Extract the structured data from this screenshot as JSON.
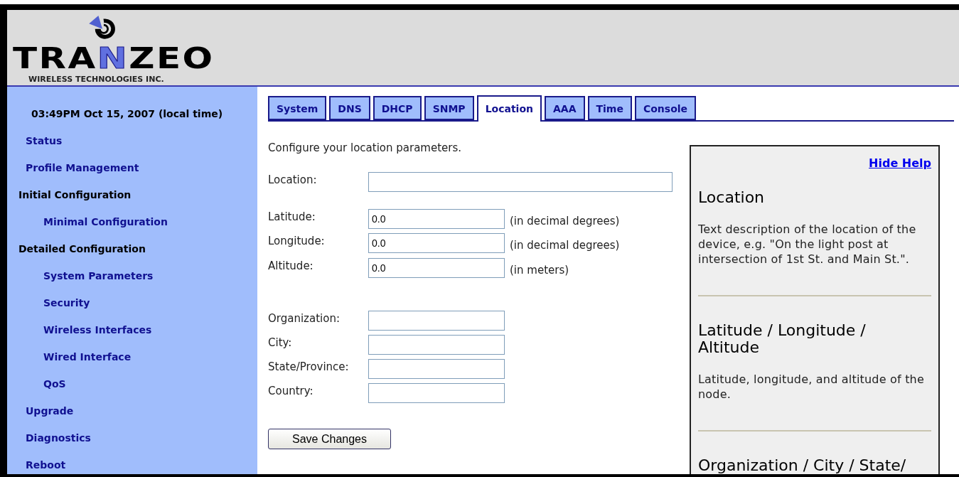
{
  "logo": {
    "wordmark": [
      {
        "text": "TRA",
        "highlighted": false
      },
      {
        "text": "N",
        "highlighted": true
      },
      {
        "text": "ZEO",
        "highlighted": false
      }
    ],
    "tagline": "WIRELESS TECHNOLOGIES INC."
  },
  "sidebar": {
    "datetime": "03:49PM Oct 15, 2007 (local time)",
    "items": [
      {
        "kind": "link",
        "label": "Status"
      },
      {
        "kind": "link",
        "label": "Profile Management"
      },
      {
        "kind": "heading",
        "label": "Initial Configuration",
        "children": [
          {
            "kind": "link",
            "label": "Minimal Configuration"
          }
        ]
      },
      {
        "kind": "heading",
        "label": "Detailed Configuration",
        "children": [
          {
            "kind": "link",
            "label": "System Parameters"
          },
          {
            "kind": "link",
            "label": "Security"
          },
          {
            "kind": "link",
            "label": "Wireless Interfaces"
          },
          {
            "kind": "link",
            "label": "Wired Interface"
          },
          {
            "kind": "link",
            "label": "QoS"
          }
        ]
      },
      {
        "kind": "link",
        "label": "Upgrade"
      },
      {
        "kind": "link",
        "label": "Diagnostics"
      },
      {
        "kind": "link",
        "label": "Reboot"
      }
    ]
  },
  "tabs": [
    {
      "label": "System",
      "selected": false
    },
    {
      "label": "DNS",
      "selected": false
    },
    {
      "label": "DHCP",
      "selected": false
    },
    {
      "label": "SNMP",
      "selected": false
    },
    {
      "label": "Location",
      "selected": true
    },
    {
      "label": "AAA",
      "selected": false
    },
    {
      "label": "Time",
      "selected": false
    },
    {
      "label": "Console",
      "selected": false
    }
  ],
  "intro": "Configure your location parameters.",
  "field_groups": [
    [
      {
        "kind": "wide",
        "label": "Location:"
      }
    ],
    [
      {
        "kind": "short",
        "label": "Latitude:",
        "value": "0.0",
        "unit": "(in decimal degrees)"
      },
      {
        "kind": "short",
        "label": "Longitude:",
        "value": "0.0",
        "unit": "(in decimal degrees)"
      },
      {
        "kind": "short",
        "label": "Altitude:",
        "value": "0.0",
        "unit": "(in meters)"
      }
    ],
    [
      {
        "kind": "short",
        "label": "Organization:"
      },
      {
        "kind": "short",
        "label": "City:"
      },
      {
        "kind": "short",
        "label": "State/Province:"
      },
      {
        "kind": "short",
        "label": "Country:"
      }
    ]
  ],
  "save_button": "Save Changes",
  "help": {
    "hide_link": "Hide Help",
    "sections": [
      {
        "title": "Location",
        "text": "Text description of the location of the device, e.g. \"On the light post at intersection of 1st St. and Main St.\"."
      },
      {
        "title": "Latitude / Longitude / Altitude",
        "text": "Latitude, longitude, and altitude of the node."
      },
      {
        "title": "Organization / City / State/"
      }
    ]
  }
}
